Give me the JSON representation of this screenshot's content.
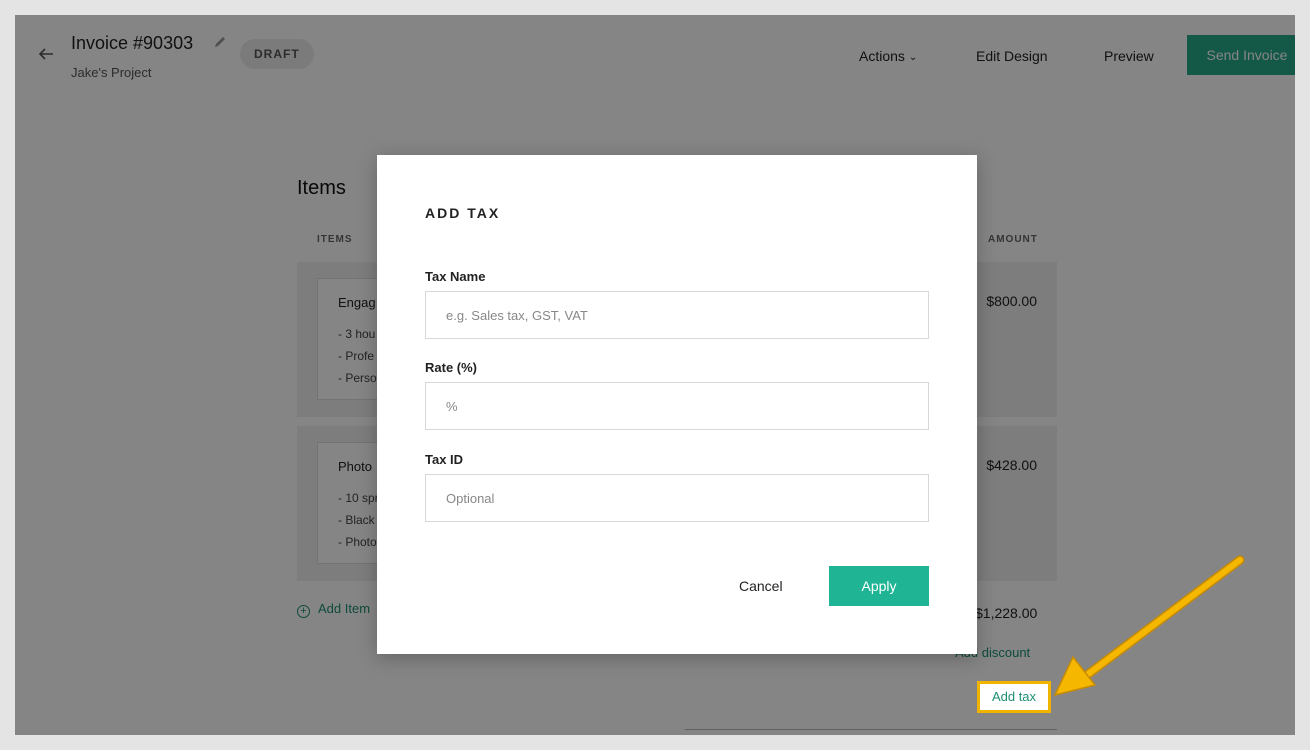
{
  "header": {
    "invoice_title": "Invoice #90303",
    "project_name": "Jake's Project",
    "status_badge": "DRAFT",
    "actions_label": "Actions",
    "edit_design_label": "Edit Design",
    "preview_label": "Preview",
    "send_invoice_label": "Send Invoice"
  },
  "items_section": {
    "title": "Items",
    "col_items": "ITEMS",
    "col_amount": "AMOUNT",
    "items": [
      {
        "name": "Engag",
        "lines": [
          "- 3 hou",
          "- Profe",
          "- Perso"
        ],
        "amount": "$800.00"
      },
      {
        "name": "Photo",
        "lines": [
          "- 10 spr",
          "- Black",
          "- Photo"
        ],
        "amount": "$428.00"
      }
    ],
    "add_item_label": "Add Item",
    "subtotal": "$1,228.00",
    "add_discount_label": "Add discount",
    "add_tax_label": "Add tax"
  },
  "modal": {
    "title": "ADD TAX",
    "tax_name_label": "Tax Name",
    "tax_name_placeholder": "e.g. Sales tax, GST, VAT",
    "rate_label": "Rate (%)",
    "rate_placeholder": "%",
    "tax_id_label": "Tax ID",
    "tax_id_placeholder": "Optional",
    "cancel_label": "Cancel",
    "apply_label": "Apply"
  },
  "colors": {
    "accent": "#1fb594",
    "link": "#1e8f73",
    "highlight": "#f0b400"
  }
}
